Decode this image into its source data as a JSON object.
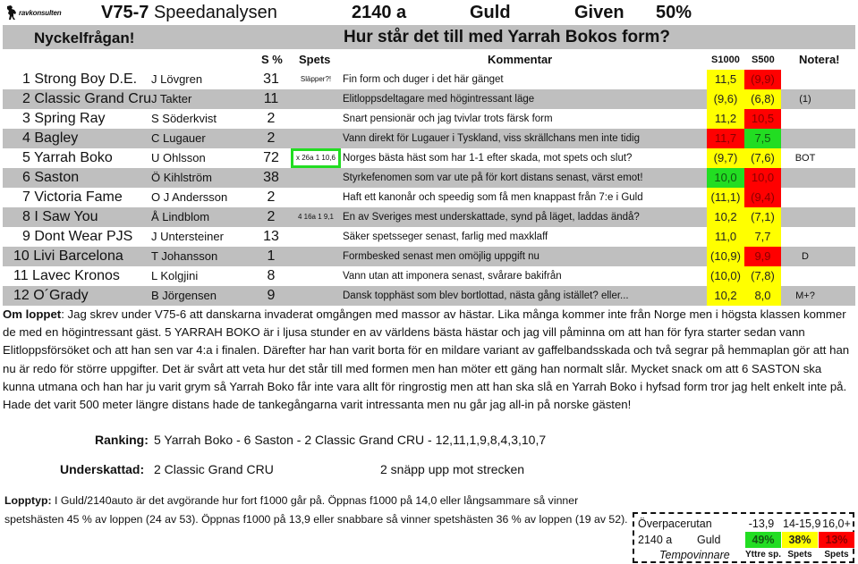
{
  "header": {
    "logo_text": "ravkonsulten",
    "race_code": "V75-7",
    "title": "Speedanalysen",
    "distance": "2140 a",
    "race_class": "Guld",
    "given_label": "Given",
    "given_pct": "50%"
  },
  "key_question": {
    "label": "Nyckelfrågan!",
    "question": "Hur står det till med Yarrah Bokos form?"
  },
  "columns": {
    "s_pct": "S %",
    "spets": "Spets",
    "comment": "Kommentar",
    "s1000": "S1000",
    "s500": "S500",
    "note": "Notera!"
  },
  "horses": [
    {
      "name": "1 Strong Boy D.E.",
      "driver": "J Lövgren",
      "s_pct": "31",
      "spets": "Släpper?!",
      "comment": "Fin form och duger i det här gänget",
      "s1000": "11,5",
      "s1000_color": "yellow",
      "s500": "(9,9)",
      "s500_color": "red",
      "note": ""
    },
    {
      "name": "2 Classic Grand Cru",
      "driver": "J Takter",
      "s_pct": "11",
      "spets": "",
      "comment": "Elitloppsdeltagare med högintressant läge",
      "s1000": "(9,6)",
      "s1000_color": "yellow",
      "s500": "(6,8)",
      "s500_color": "yellow",
      "note": "(1)"
    },
    {
      "name": "3 Spring Ray",
      "driver": "S Söderkvist",
      "s_pct": "2",
      "spets": "",
      "comment": "Snart pensionär och jag tvivlar trots färsk form",
      "s1000": "11,2",
      "s1000_color": "yellow",
      "s500": "10,5",
      "s500_color": "red",
      "note": ""
    },
    {
      "name": "4 Bagley",
      "driver": "C Lugauer",
      "s_pct": "2",
      "spets": "",
      "comment": "Vann direkt för Lugauer i Tyskland, viss skrällchans men inte tidig",
      "s1000": "11,7",
      "s1000_color": "red",
      "s500": "7,5",
      "s500_color": "green",
      "note": ""
    },
    {
      "name": "5 Yarrah Boko",
      "driver": "U Ohlsson",
      "s_pct": "72",
      "spets": "x 26a 1 10,6",
      "comment": "Norges bästa häst som har 1-1 efter skada, mot spets och slut?",
      "s1000": "(9,7)",
      "s1000_color": "yellow",
      "s500": "(7,6)",
      "s500_color": "yellow",
      "note": "BOT"
    },
    {
      "name": "6 Saston",
      "driver": "Ö Kihlström",
      "s_pct": "38",
      "spets": "",
      "comment": "Styrkefenomen som var ute på för kort distans senast, värst emot!",
      "s1000": "10,0",
      "s1000_color": "green",
      "s500": "10,0",
      "s500_color": "red",
      "note": ""
    },
    {
      "name": "7 Victoria Fame",
      "driver": "O J Andersson",
      "s_pct": "2",
      "spets": "",
      "comment": "Haft ett kanonår och speedig som få men knappast från 7:e i Guld",
      "s1000": "(11,1)",
      "s1000_color": "yellow",
      "s500": "(9,4)",
      "s500_color": "red",
      "note": ""
    },
    {
      "name": "8 I Saw You",
      "driver": "Å Lindblom",
      "s_pct": "2",
      "spets": "4 16a 1  9,1",
      "comment": "En av Sveriges mest underskattade, synd på läget, laddas ändå?",
      "s1000": "10,2",
      "s1000_color": "yellow",
      "s500": "(7,1)",
      "s500_color": "yellow",
      "note": ""
    },
    {
      "name": "9 Dont Wear PJS",
      "driver": "J Untersteiner",
      "s_pct": "13",
      "spets": "",
      "comment": "Säker spetsseger senast, farlig med maxklaff",
      "s1000": "11,0",
      "s1000_color": "yellow",
      "s500": "7,7",
      "s500_color": "yellow",
      "note": ""
    },
    {
      "name": "10 Livi Barcelona",
      "driver": "T Johansson",
      "s_pct": "1",
      "spets": "",
      "comment": "Formbesked senast men omöjlig uppgift nu",
      "s1000": "(10,9)",
      "s1000_color": "yellow",
      "s500": "9,9",
      "s500_color": "red",
      "note": "D"
    },
    {
      "name": "11 Lavec Kronos",
      "driver": "L Kolgjini",
      "s_pct": "8",
      "spets": "",
      "comment": " Vann utan att imponera senast, svårare bakifrån",
      "s1000": "(10,0)",
      "s1000_color": "yellow",
      "s500": "(7,8)",
      "s500_color": "yellow",
      "note": ""
    },
    {
      "name": "12 O´Grady",
      "driver": "B Jörgensen",
      "s_pct": "9",
      "spets": "",
      "comment": "Dansk topphäst som blev bortlottad, nästa gång istället? eller...",
      "s1000": "10,2",
      "s1000_color": "yellow",
      "s500": "8,0",
      "s500_color": "yellow",
      "note": "M+?"
    }
  ],
  "about": {
    "label": "Om loppet",
    "text": ": Jag skrev under V75-6 att danskarna invaderat omgången med massor av hästar. Lika många kommer inte från Norge men i högsta klassen kommer de med en högintressant gäst. 5 YARRAH BOKO är i ljusa stunder en av världens bästa hästar och jag vill påminna om att han för fyra starter sedan vann Elitloppsförsöket och att han sen var 4:a i finalen. Därefter har han varit borta för en mildare variant av gaffelbandsskada och två segrar på hemmaplan gör att han nu är redo för större uppgifter. Det är svårt att veta hur det står till med formen men han möter ett gäng han normalt slår. Mycket snack om att 6 SASTON ska kunna utmana och han har ju varit grym så Yarrah Boko får inte vara allt för ringrostig men att han ska slå en Yarrah Boko i hyfsad form tror jag helt enkelt inte på. Hade det varit 500 meter längre distans hade de tankegångarna varit intressanta men nu går jag all-in på norske gästen!"
  },
  "ranking": {
    "label": "Ranking:",
    "value": "5 Yarrah Boko - 6 Saston - 2 Classic Grand CRU - 12,11,1,9,8,4,3,10,7"
  },
  "underrated": {
    "label": "Underskattad:",
    "value": "2 Classic Grand CRU",
    "note": "2 snäpp upp mot strecken"
  },
  "race_type": {
    "label": "Lopptyp:",
    "text": " I Guld/2140auto är det avgörande hur fort f1000 går på. Öppnas f1000 på 14,0 eller långsammare så vinner spetshästen 45 % av loppen (24 av 53). Öppnas f1000 på 13,9 eller snabbare så vinner spetshästen 36 % av loppen (19 av 52)."
  },
  "tempo_box": {
    "title": "Överpacerutan",
    "distance": "2140 a",
    "race_class": "Guld",
    "subtitle": "Tempovinnare",
    "columns": [
      {
        "range": "-13,9",
        "pct": "49%",
        "color": "green",
        "winner": "Yttre sp."
      },
      {
        "range": "14-15,9",
        "pct": "38%",
        "color": "yellow",
        "winner": "Spets"
      },
      {
        "range": "16,0+",
        "pct": "13%",
        "color": "red",
        "winner": "Spets"
      }
    ]
  },
  "colors": {
    "yellow": "#ffff00",
    "red": "#ff0000",
    "green": "#22dd22",
    "grey_row": "#bfbfbf",
    "spets_box": "#22dd22"
  }
}
